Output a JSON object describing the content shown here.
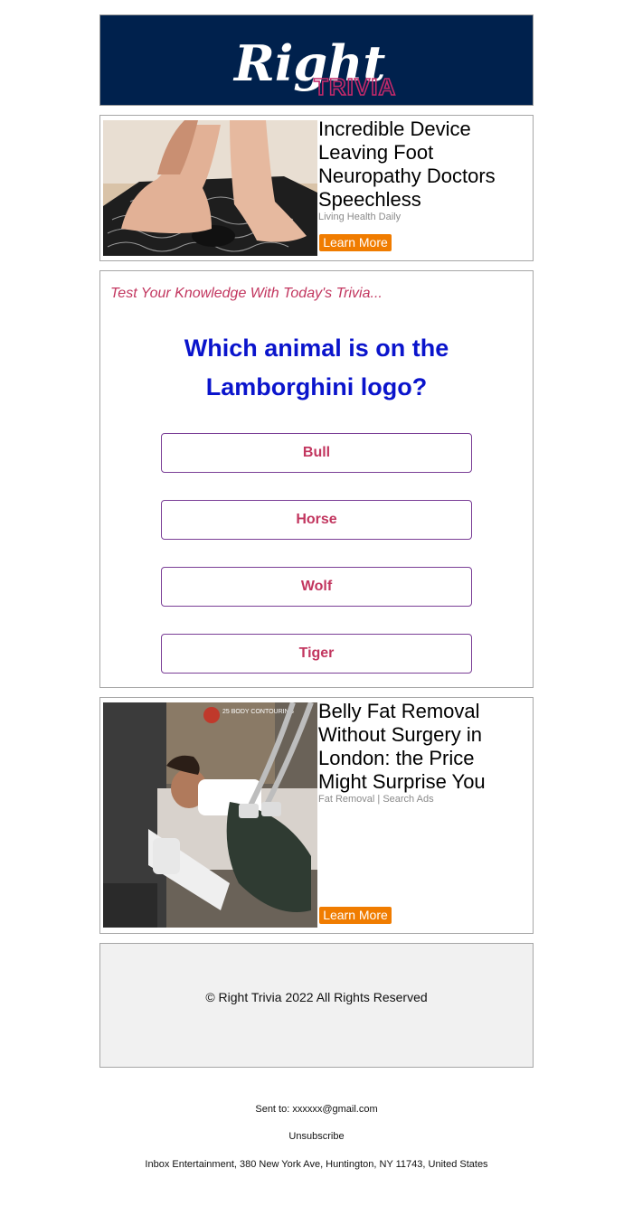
{
  "header": {
    "logo_script": "Right",
    "logo_word": "TRIVIA",
    "colors": {
      "background": "#00214d",
      "script": "#ffffff",
      "word": "#c2296a"
    }
  },
  "ad1": {
    "title": "Incredible Device Leaving Foot Neuropathy Doctors Speechless",
    "source": "Living Health Daily",
    "cta": "Learn More",
    "image": "feet-on-massage-mat-photo"
  },
  "trivia": {
    "prompt": "Test Your Knowledge With Today's Trivia...",
    "question": "Which animal is on the Lamborghini logo?",
    "answers": [
      "Bull",
      "Horse",
      "Wolf",
      "Tiger"
    ]
  },
  "ad2": {
    "title": "Belly Fat Removal Without Surgery in London: the Price Might Surprise You",
    "source": "Fat Removal | Search Ads",
    "cta": "Learn More",
    "image": "woman-body-contouring-treatment-photo",
    "image_badge": "25 BODY CONTOURING"
  },
  "footer": {
    "copyright": "© Right Trivia 2022 All Rights Reserved"
  },
  "email_footer": {
    "sent_to": "Sent to: xxxxxx@gmail.com",
    "unsubscribe": "Unsubscribe",
    "address": "Inbox Entertainment, 380 New York Ave, Huntington, NY 11743, United States"
  },
  "colors": {
    "accent_button": "#f07c00",
    "answer_text": "#c2365f",
    "question_text": "#0a14cc"
  }
}
